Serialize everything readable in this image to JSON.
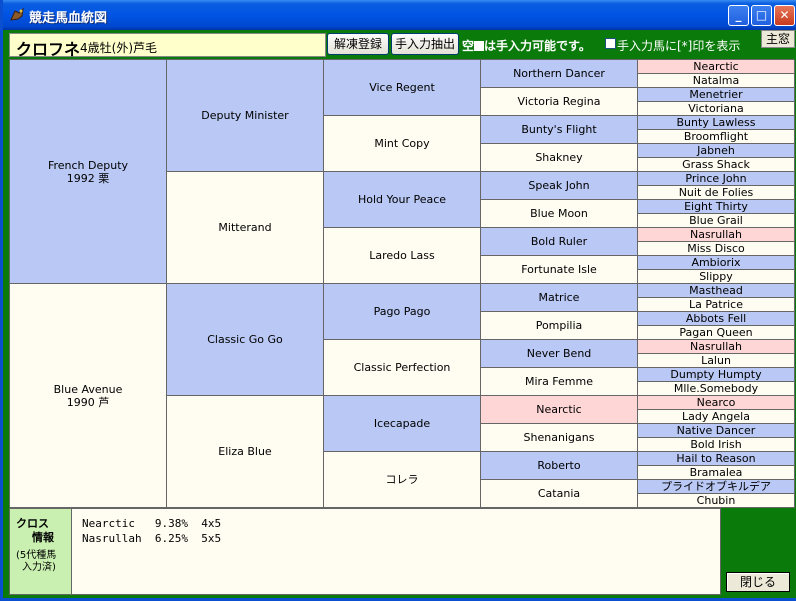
{
  "window": {
    "title": "競走馬血統図"
  },
  "header": {
    "horse_name": "クロフネ",
    "horse_info": "4歳牡(外)芦毛",
    "unfreeze_label": "解凍登録",
    "extract_label": "手入力抽出",
    "hint_pre": "空",
    "hint_post": "は手入力可能です。",
    "checkbox_label": "手入力馬に[*]印を表示",
    "main_label": "主窓"
  },
  "pedigree": {
    "gen1": [
      {
        "text": "French Deputy\n1992 栗",
        "color": "blue"
      },
      {
        "text": "Blue Avenue\n1990 芦",
        "color": "white"
      }
    ],
    "gen2": [
      {
        "text": "Deputy Minister",
        "color": "blue"
      },
      {
        "text": "Mitterand",
        "color": "white"
      },
      {
        "text": "Classic Go Go",
        "color": "blue"
      },
      {
        "text": "Eliza Blue",
        "color": "white"
      }
    ],
    "gen3": [
      {
        "text": "Vice Regent",
        "color": "blue"
      },
      {
        "text": "Mint Copy",
        "color": "white"
      },
      {
        "text": "Hold Your Peace",
        "color": "blue"
      },
      {
        "text": "Laredo Lass",
        "color": "white"
      },
      {
        "text": "Pago Pago",
        "color": "blue"
      },
      {
        "text": "Classic Perfection",
        "color": "white"
      },
      {
        "text": "Icecapade",
        "color": "blue"
      },
      {
        "text": "コレラ",
        "color": "white"
      }
    ],
    "gen4": [
      {
        "text": "Northern Dancer",
        "color": "blue"
      },
      {
        "text": "Victoria Regina",
        "color": "white"
      },
      {
        "text": "Bunty's Flight",
        "color": "blue"
      },
      {
        "text": "Shakney",
        "color": "white"
      },
      {
        "text": "Speak John",
        "color": "blue"
      },
      {
        "text": "Blue Moon",
        "color": "white"
      },
      {
        "text": "Bold Ruler",
        "color": "blue"
      },
      {
        "text": "Fortunate Isle",
        "color": "white"
      },
      {
        "text": "Matrice",
        "color": "blue"
      },
      {
        "text": "Pompilia",
        "color": "white"
      },
      {
        "text": "Never Bend",
        "color": "blue"
      },
      {
        "text": "Mira Femme",
        "color": "white"
      },
      {
        "text": "Nearctic",
        "color": "pink"
      },
      {
        "text": "Shenanigans",
        "color": "white"
      },
      {
        "text": "Roberto",
        "color": "blue"
      },
      {
        "text": "Catania",
        "color": "white"
      }
    ],
    "gen5": [
      {
        "text": "Nearctic",
        "color": "pink"
      },
      {
        "text": "Natalma",
        "color": "white"
      },
      {
        "text": "Menetrier",
        "color": "blue"
      },
      {
        "text": "Victoriana",
        "color": "white"
      },
      {
        "text": "Bunty Lawless",
        "color": "blue"
      },
      {
        "text": "Broomflight",
        "color": "white"
      },
      {
        "text": "Jabneh",
        "color": "blue"
      },
      {
        "text": "Grass Shack",
        "color": "white"
      },
      {
        "text": "Prince John",
        "color": "blue"
      },
      {
        "text": "Nuit de Folies",
        "color": "white"
      },
      {
        "text": "Eight Thirty",
        "color": "blue"
      },
      {
        "text": "Blue Grail",
        "color": "white"
      },
      {
        "text": "Nasrullah",
        "color": "pink"
      },
      {
        "text": "Miss Disco",
        "color": "white"
      },
      {
        "text": "Ambiorix",
        "color": "blue"
      },
      {
        "text": "Slippy",
        "color": "white"
      },
      {
        "text": "Masthead",
        "color": "blue"
      },
      {
        "text": "La Patrice",
        "color": "white"
      },
      {
        "text": "Abbots Fell",
        "color": "blue"
      },
      {
        "text": "Pagan Queen",
        "color": "white"
      },
      {
        "text": "Nasrullah",
        "color": "pink"
      },
      {
        "text": "Lalun",
        "color": "white"
      },
      {
        "text": "Dumpty Humpty",
        "color": "blue"
      },
      {
        "text": "Mlle.Somebody",
        "color": "white"
      },
      {
        "text": "Nearco",
        "color": "pink"
      },
      {
        "text": "Lady Angela",
        "color": "white"
      },
      {
        "text": "Native Dancer",
        "color": "blue"
      },
      {
        "text": "Bold Irish",
        "color": "white"
      },
      {
        "text": "Hail to Reason",
        "color": "blue"
      },
      {
        "text": "Bramalea",
        "color": "white"
      },
      {
        "text": "プライドオブキルデア",
        "color": "blue"
      },
      {
        "text": "Chubin",
        "color": "white"
      }
    ]
  },
  "cross": {
    "title1": "クロス",
    "title2": "情報",
    "sub1": "(5代種馬",
    "sub2": "入力済)",
    "rows": [
      "Nearctic   9.38%  4x5",
      "Nasrullah  6.25%  5x5"
    ]
  },
  "footer": {
    "close_label": "閉じる"
  }
}
